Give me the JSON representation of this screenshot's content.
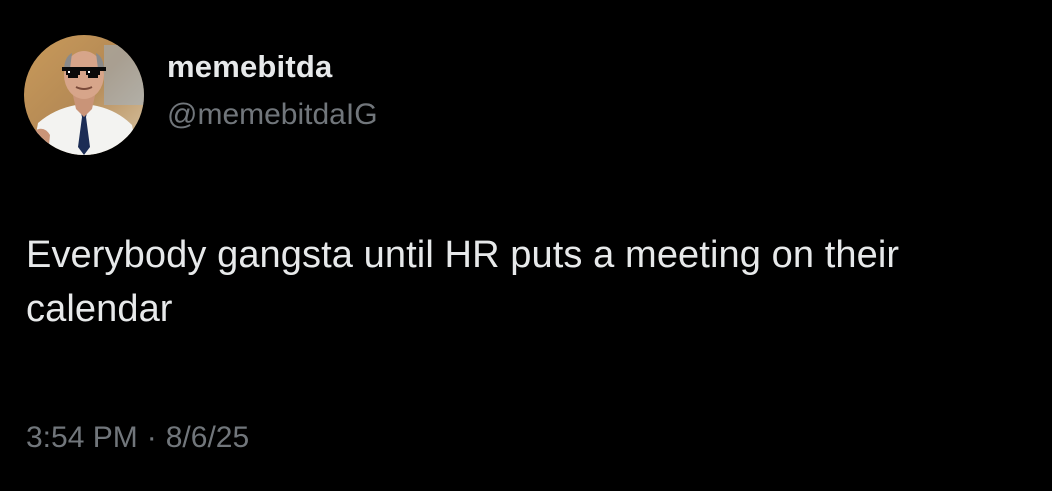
{
  "author": {
    "display_name": "memebitda",
    "handle": "@memebitdaIG",
    "avatar_icon": "profile-photo-man-with-pixel-sunglasses"
  },
  "tweet": {
    "text": "Everybody gangsta until HR puts a meeting on their calendar",
    "time": "3:54 PM",
    "separator": "·",
    "date": "8/6/25"
  },
  "colors": {
    "background": "#000000",
    "primary_text": "#e7e9ea",
    "secondary_text": "#71767b"
  }
}
